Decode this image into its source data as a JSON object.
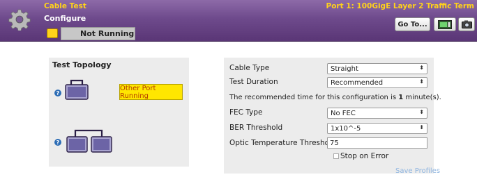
{
  "header": {
    "app_title": "Cable Test",
    "section": "Configure",
    "port_title": "Port 1: 100GigE Layer 2 Traffic Term",
    "goto_label": "Go To...",
    "gear_icon": "gear-icon",
    "instrument_icon": "instrument-icon",
    "camera_icon": "camera-icon"
  },
  "status": {
    "text": "Not Running"
  },
  "topology": {
    "title": "Test Topology",
    "other_port_label": "Other Port Running",
    "help_symbol": "?"
  },
  "config": {
    "cable_type": {
      "label": "Cable Type",
      "value": "Straight"
    },
    "test_duration": {
      "label": "Test Duration",
      "value": "Recommended"
    },
    "recommendation": {
      "prefix": "The recommended time for this configuration is ",
      "value": "1",
      "suffix": " minute(s)."
    },
    "fec_type": {
      "label": "FEC Type",
      "value": "No FEC"
    },
    "ber_threshold": {
      "label": "BER Threshold",
      "value": "1x10^-5"
    },
    "optic_temp": {
      "label": "Optic Temperature Threshold (C)",
      "value": "75"
    },
    "stop_on_error": {
      "label": "Stop on Error",
      "checked": false
    },
    "save_profiles": "Save Profiles"
  },
  "colors": {
    "header_purple": "#6e4a8c",
    "title_yellow": "#ffd21a",
    "badge_yellow": "#ffe600",
    "link_blue": "#8fb5e0"
  }
}
